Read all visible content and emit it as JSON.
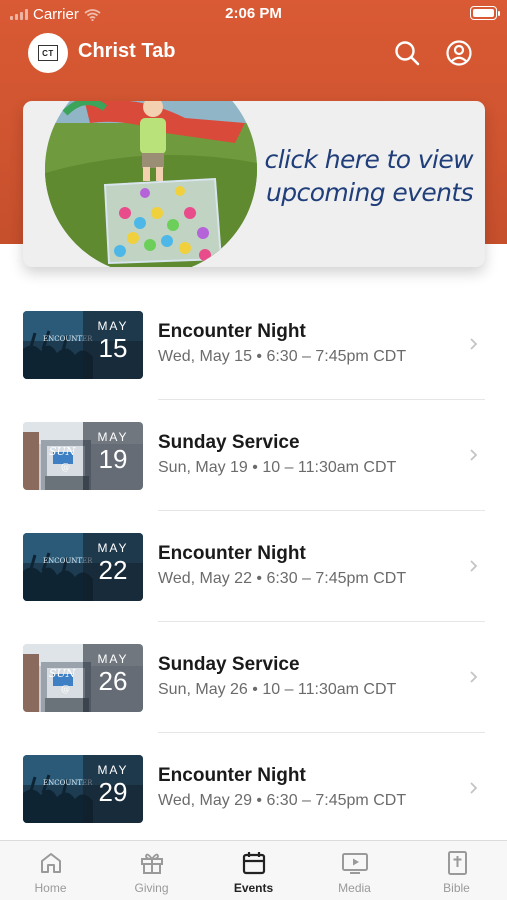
{
  "status_bar": {
    "carrier": "Carrier",
    "time": "2:06 PM"
  },
  "app": {
    "logo_text": "CT",
    "title": "Christ Tab"
  },
  "banner": {
    "text_line1": "click here to view",
    "text_line2": "upcoming events"
  },
  "events": [
    {
      "thumb": "encounter",
      "month": "MAY",
      "day": "15",
      "title": "Encounter Night",
      "when": "Wed, May 15 • 6:30 – 7:45pm CDT"
    },
    {
      "thumb": "sunday",
      "month": "MAY",
      "day": "19",
      "title": "Sunday Service",
      "when": "Sun, May 19 • 10 – 11:30am CDT"
    },
    {
      "thumb": "encounter",
      "month": "MAY",
      "day": "22",
      "title": "Encounter Night",
      "when": "Wed, May 22 • 6:30 – 7:45pm CDT"
    },
    {
      "thumb": "sunday",
      "month": "MAY",
      "day": "26",
      "title": "Sunday Service",
      "when": "Sun, May 26 • 10 – 11:30am CDT"
    },
    {
      "thumb": "encounter",
      "month": "MAY",
      "day": "29",
      "title": "Encounter Night",
      "when": "Wed, May 29 • 6:30 – 7:45pm CDT"
    }
  ],
  "tabs": [
    {
      "label": "Home",
      "icon": "home-icon",
      "active": false
    },
    {
      "label": "Giving",
      "icon": "gift-icon",
      "active": false
    },
    {
      "label": "Events",
      "icon": "calendar-icon",
      "active": true
    },
    {
      "label": "Media",
      "icon": "tv-play-icon",
      "active": false
    },
    {
      "label": "Bible",
      "icon": "bible-icon",
      "active": false
    }
  ],
  "colors": {
    "header": "#d95a34",
    "banner_text": "#1f3e7a",
    "tab_active": "#222222",
    "tab_inactive": "#9a9a9a"
  }
}
